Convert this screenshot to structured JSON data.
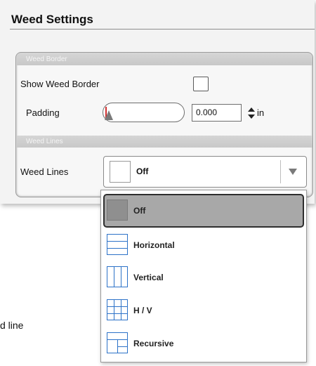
{
  "panel": {
    "title": "Weed Settings",
    "weed_border_section": {
      "heading": "Weed Border",
      "show_label": "Show Weed Border",
      "show_checked": false,
      "padding_label": "Padding",
      "padding_value": "0.000",
      "padding_unit": "in",
      "padding_slider_level": 0
    },
    "weed_lines_section": {
      "heading": "Weed Lines",
      "label": "Weed Lines",
      "selected_value": "Off"
    }
  },
  "dropdown": {
    "options": [
      {
        "label": "Off",
        "icon": "off-swatch-icon",
        "selected": true
      },
      {
        "label": "Horizontal",
        "icon": "horizontal-lines-icon",
        "selected": false
      },
      {
        "label": "Vertical",
        "icon": "vertical-lines-icon",
        "selected": false
      },
      {
        "label": "H / V",
        "icon": "grid-lines-icon",
        "selected": false
      },
      {
        "label": "Recursive",
        "icon": "recursive-lines-icon",
        "selected": false
      }
    ]
  },
  "background_text": "d line",
  "colors": {
    "accent_blue": "#2c72c8",
    "selected_item": "#a8a8a8",
    "slider_marker": "#d03030"
  }
}
